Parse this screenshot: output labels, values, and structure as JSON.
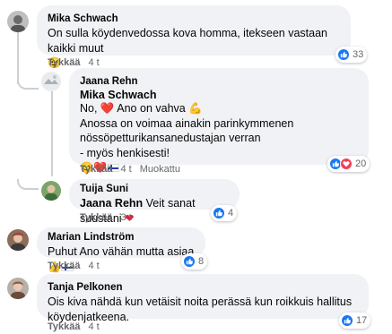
{
  "comments": [
    {
      "author": "Mika Schwach",
      "text": "On sulla köydenvedossa kova homma, itekseen vastaan kaikki muut",
      "emoji": "😉",
      "like_label": "Tykkää",
      "time": "4 t",
      "reactions": "33"
    },
    {
      "author": "Jaana Rehn",
      "mention": "Mika Schwach",
      "line1": "No, ❤️ Ano on vahva 💪",
      "line2": "Anossa on voimaa ainakin parinkymmenen",
      "line3": "nössöpetturikansanedustajan verran",
      "line4": "- myös henkisesti!",
      "emojis": "😊❤️",
      "like_label": "Tykkää",
      "time": "4 t",
      "edited": "Muokattu",
      "reactions": "20"
    },
    {
      "author": "Tuija Suni",
      "mention": "Jaana Rehn",
      "text": "Veit sanat suustani",
      "like_label": "Tykkää",
      "time": "3 t",
      "reactions": "4"
    },
    {
      "author": "Marian Lindström",
      "text": "Puhut Ano vähän mutta asiaa",
      "emoji": "👍",
      "like_label": "Tykkää",
      "time": "4 t",
      "reactions": "8"
    },
    {
      "author": "Tanja Pelkonen",
      "text": "Ois kiva nähdä kun vetäisit noita perässä kun roikkuis hallitus köydenjatkeena.",
      "like_label": "Tykkää",
      "time": "4 t",
      "reactions": "17"
    }
  ],
  "colors": {
    "bubble": "#f0f2f5",
    "like_blue": "#1877f2",
    "love_red": "#f33e58",
    "meta_grey": "#65676b"
  }
}
